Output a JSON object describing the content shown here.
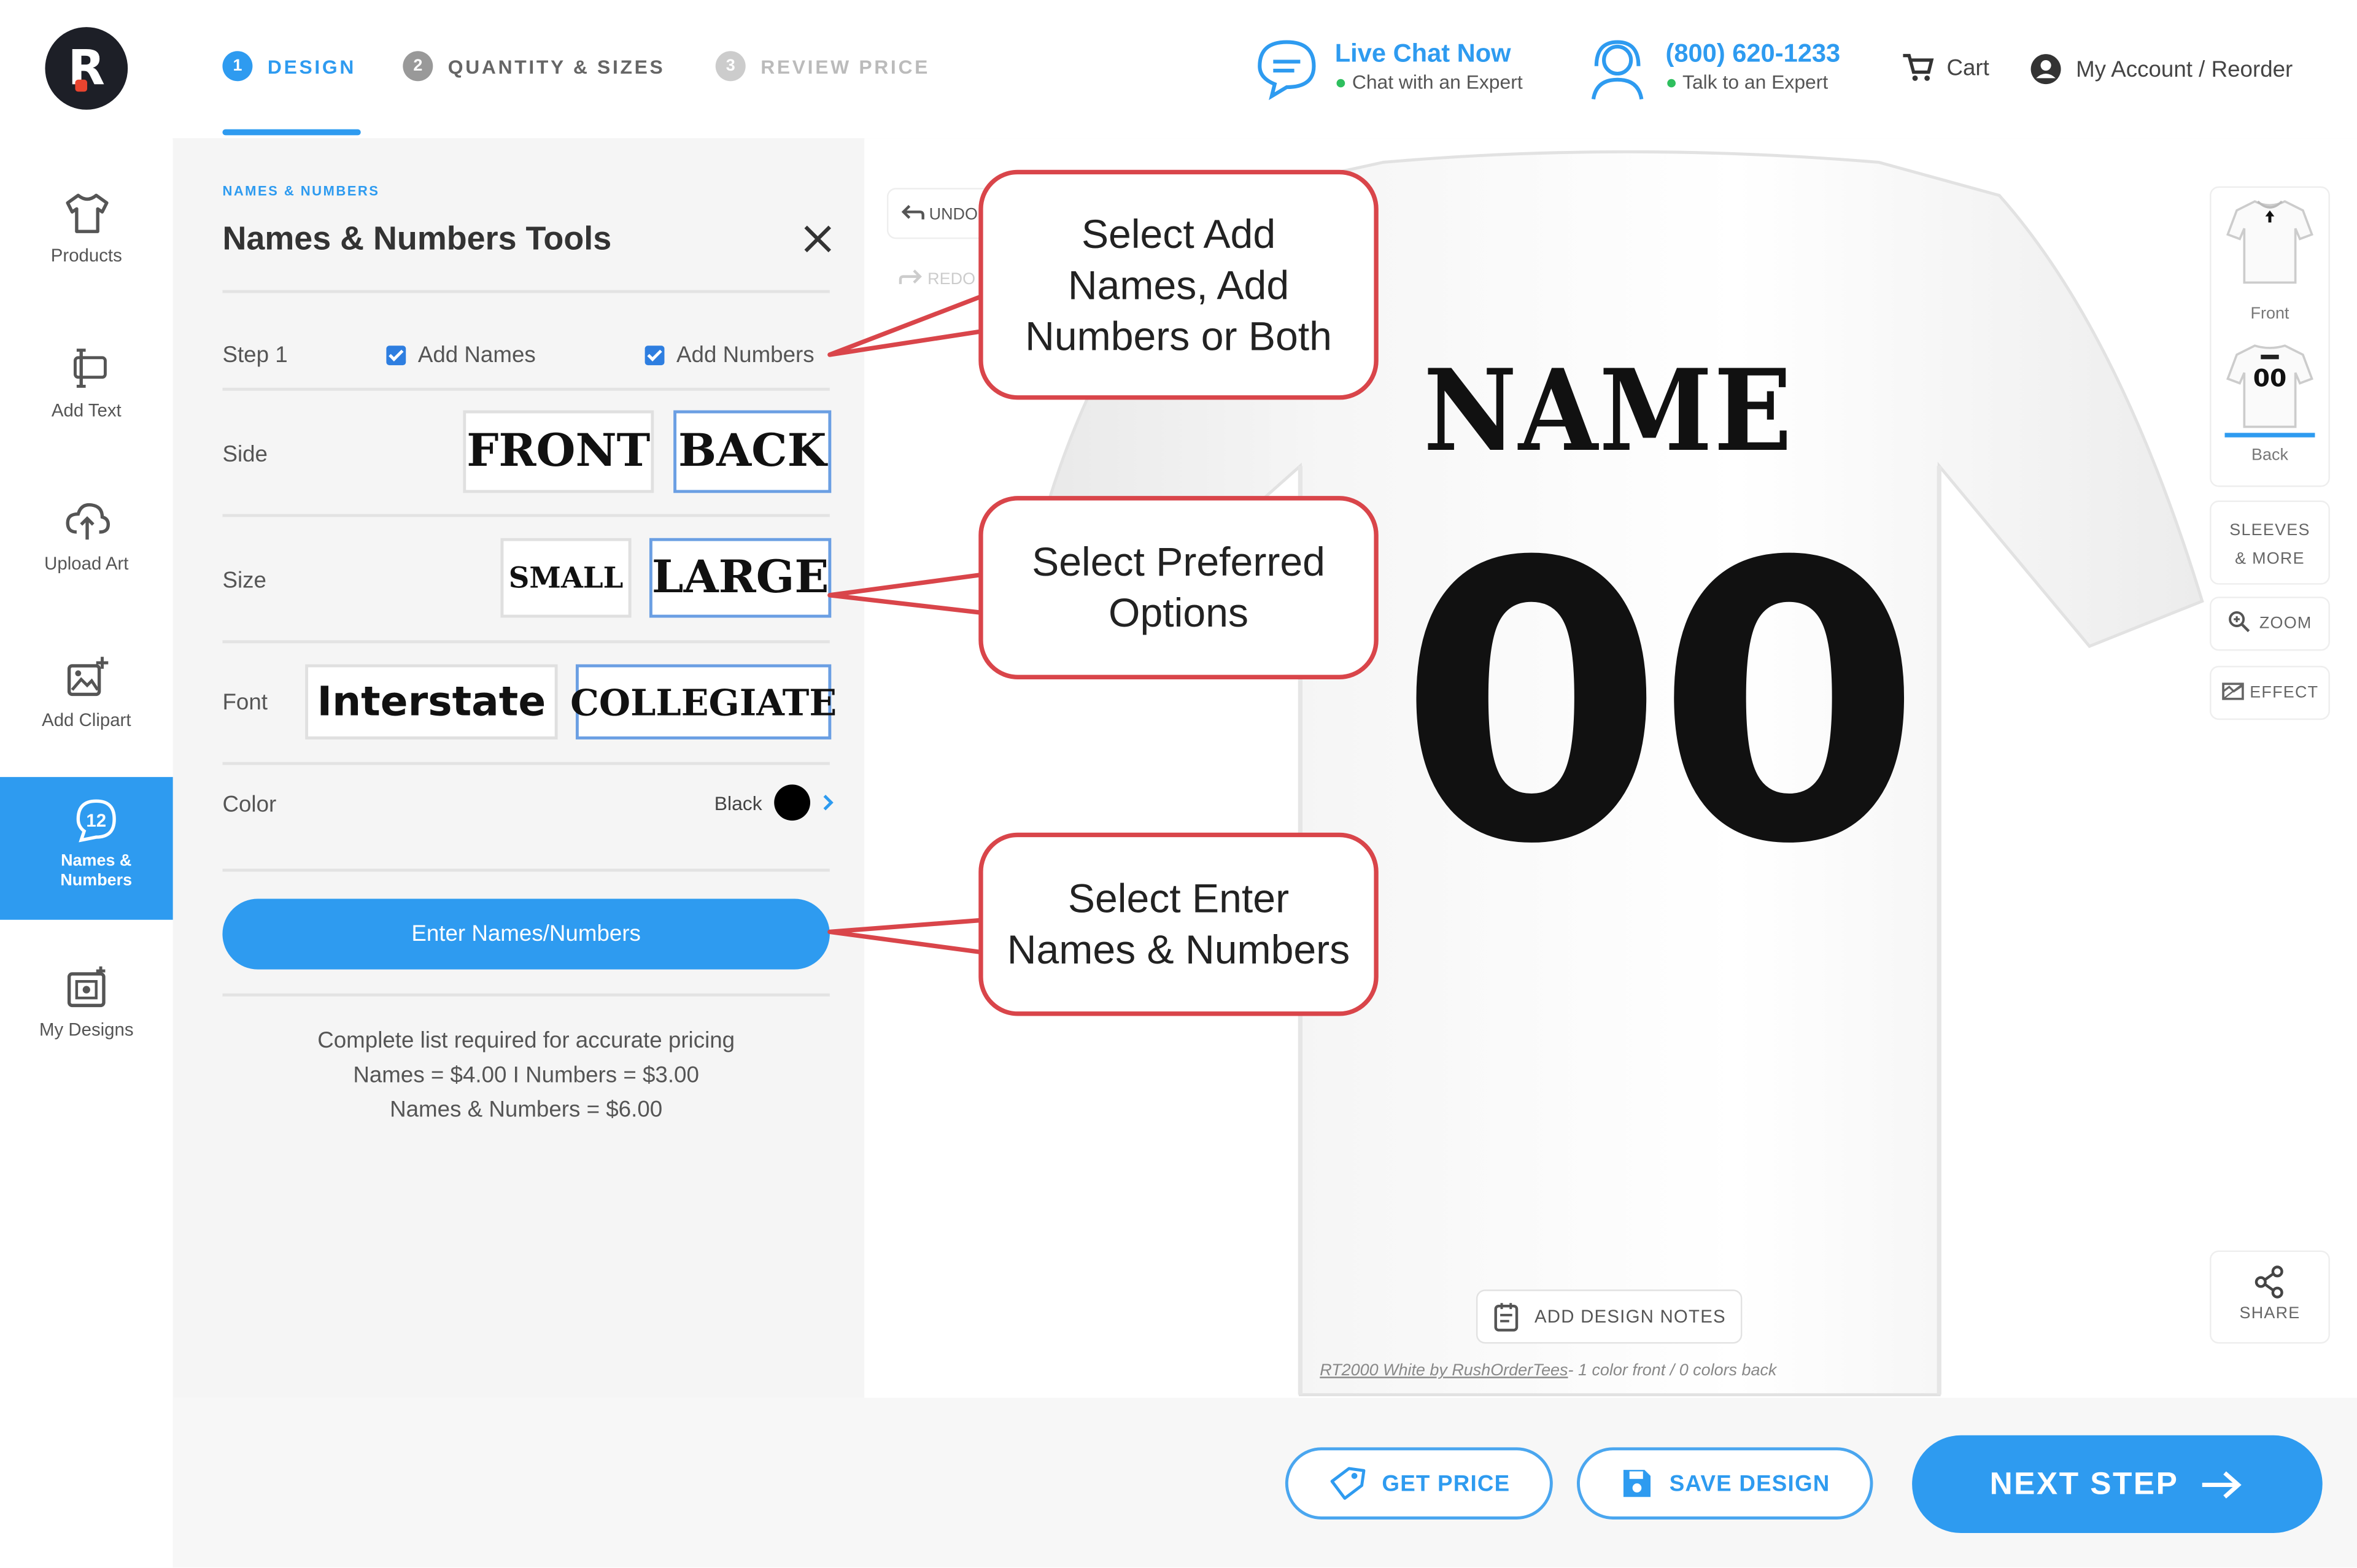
{
  "nav": {
    "items": [
      {
        "label": "Products"
      },
      {
        "label": "Add Text"
      },
      {
        "label": "Upload Art"
      },
      {
        "label": "Add Clipart"
      },
      {
        "label": "Names & Numbers"
      },
      {
        "label": "My Designs"
      }
    ]
  },
  "header": {
    "steps": [
      {
        "num": "1",
        "label": "DESIGN"
      },
      {
        "num": "2",
        "label": "QUANTITY & SIZES"
      },
      {
        "num": "3",
        "label": "REVIEW PRICE"
      }
    ],
    "live_chat": {
      "title": "Live Chat Now",
      "subtitle": "Chat with an Expert"
    },
    "phone": {
      "title": "(800) 620-1233",
      "subtitle": "Talk to an Expert"
    },
    "cart": "Cart",
    "account": "My Account / Reorder"
  },
  "panel": {
    "eyebrow": "NAMES & NUMBERS",
    "title": "Names & Numbers Tools",
    "step_label": "Step 1",
    "add_names": "Add Names",
    "add_numbers": "Add Numbers",
    "side_label": "Side",
    "side_front": "FRONT",
    "side_back": "BACK",
    "size_label": "Size",
    "size_small": "SMALL",
    "size_large": "LARGE",
    "font_label": "Font",
    "font_interstate": "Interstate",
    "font_collegiate": "COLLEGIATE",
    "color_label": "Color",
    "color_value": "Black",
    "color_hex": "#000000",
    "enter_button": "Enter Names/Numbers",
    "pricing_note": "Complete list required for accurate pricing",
    "pricing_line1": "Names = $4.00 I Numbers = $3.00",
    "pricing_line2": "Names & Numbers = $6.00"
  },
  "canvas": {
    "undo": "UNDO",
    "redo": "REDO",
    "shirt_name": "NAME",
    "shirt_number": "00",
    "design_notes": "ADD DESIGN NOTES",
    "product_link": "RT2000 White by RushOrderTees",
    "product_info": "- 1 color front / 0 colors back"
  },
  "right_tools": {
    "front": "Front",
    "back": "Back",
    "back_thumb_num": "00",
    "sleeves": "SLEEVES & MORE",
    "zoom": "ZOOM",
    "effect": "EFFECT",
    "share": "SHARE"
  },
  "callouts": {
    "c1": "Select Add Names, Add Numbers or Both",
    "c2": "Select Preferred Options",
    "c3": "Select Enter Names & Numbers"
  },
  "footer": {
    "get_price": "GET PRICE",
    "save_design": "SAVE DESIGN",
    "next_step": "NEXT STEP"
  },
  "colors": {
    "accent": "#2e9bf0",
    "callout_border": "#d9454a",
    "status_online": "#2ebf5e"
  }
}
